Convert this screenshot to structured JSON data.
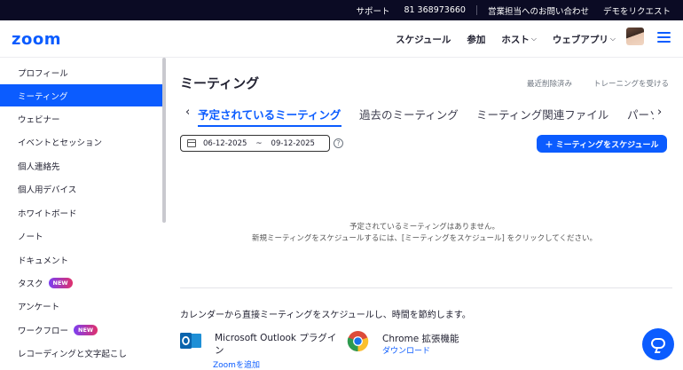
{
  "topbar": {
    "support": "サポート",
    "phone": "81 368973660",
    "contact_sales": "営業担当へのお問い合わせ",
    "request_demo": "デモをリクエスト"
  },
  "nav": {
    "logo": "zoom",
    "items": [
      {
        "label": "スケジュール",
        "dropdown": false
      },
      {
        "label": "参加",
        "dropdown": false
      },
      {
        "label": "ホスト",
        "dropdown": true
      },
      {
        "label": "ウェブアプリ",
        "dropdown": true
      }
    ],
    "avatar_icon": "user-avatar",
    "menu_icon": "hamburger-menu-icon"
  },
  "sidebar": {
    "items": [
      {
        "label": "プロフィール",
        "active": false,
        "badge": ""
      },
      {
        "label": "ミーティング",
        "active": true,
        "badge": ""
      },
      {
        "label": "ウェビナー",
        "active": false,
        "badge": ""
      },
      {
        "label": "イベントとセッション",
        "active": false,
        "badge": ""
      },
      {
        "label": "個人連絡先",
        "active": false,
        "badge": ""
      },
      {
        "label": "個人用デバイス",
        "active": false,
        "badge": ""
      },
      {
        "label": "ホワイトボード",
        "active": false,
        "badge": ""
      },
      {
        "label": "ノート",
        "active": false,
        "badge": ""
      },
      {
        "label": "ドキュメント",
        "active": false,
        "badge": ""
      },
      {
        "label": "タスク",
        "active": false,
        "badge": "NEW"
      },
      {
        "label": "アンケート",
        "active": false,
        "badge": ""
      },
      {
        "label": "ワークフロー",
        "active": false,
        "badge": "NEW"
      },
      {
        "label": "レコーディングと文字起こし",
        "active": false,
        "badge": ""
      }
    ]
  },
  "main": {
    "title": "ミーティング",
    "recently_deleted": "最近削除済み",
    "get_training": "トレーニングを受ける",
    "tabs": [
      {
        "label": "予定されているミーティング",
        "active": true
      },
      {
        "label": "過去のミーティング",
        "active": false
      },
      {
        "label": "ミーティング関連ファイル",
        "active": false
      },
      {
        "label": "パーソ",
        "active": false
      }
    ],
    "date_from": "06-12-2025",
    "date_sep": "~",
    "date_to": "09-12-2025",
    "schedule_button": "＋ ミーティングをスケジュール",
    "empty_line1": "予定されているミーティングはありません。",
    "empty_line2": "新規ミーティングをスケジュールするには、[ミーティングをスケジュール] をクリックしてください。",
    "promo_text": "カレンダーから直接ミーティングをスケジュールし、時間を節約します。",
    "outlook_title": "Microsoft Outlook プラグイン",
    "outlook_link": "Zoomを追加",
    "chrome_title": "Chrome 拡張機能",
    "chrome_link": "ダウンロード"
  },
  "colors": {
    "brand": "#0b5cff",
    "topbar_bg": "#0b0b24"
  }
}
